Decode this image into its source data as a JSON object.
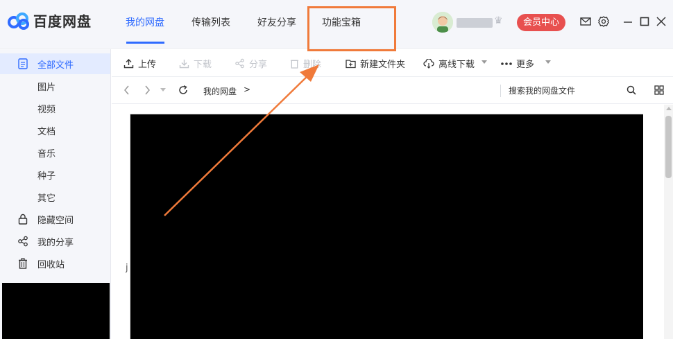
{
  "app": {
    "name": "百度网盘",
    "brand_color": "#2f6bff",
    "accent_color": "#e8504f",
    "highlight_color": "#f07a3a"
  },
  "nav": {
    "tabs": [
      {
        "label": "我的网盘",
        "active": true
      },
      {
        "label": "传输列表",
        "active": false
      },
      {
        "label": "好友分享",
        "active": false
      },
      {
        "label": "功能宝箱",
        "active": false
      }
    ]
  },
  "user": {
    "vip_button": "会员中心",
    "icons": [
      "mail-icon",
      "gear-icon",
      "minimize-icon",
      "maximize-icon",
      "close-icon"
    ]
  },
  "sidebar": {
    "items": [
      {
        "label": "全部文件",
        "icon": "file-icon",
        "active": true
      },
      {
        "label": "图片"
      },
      {
        "label": "视频"
      },
      {
        "label": "文档"
      },
      {
        "label": "音乐"
      },
      {
        "label": "种子"
      },
      {
        "label": "其它"
      },
      {
        "label": "隐藏空间",
        "icon": "lock-icon"
      },
      {
        "label": "我的分享",
        "icon": "share-icon"
      },
      {
        "label": "回收站",
        "icon": "trash-icon"
      }
    ]
  },
  "toolbar": {
    "upload": "上传",
    "download": "下载",
    "share": "分享",
    "delete": "删除",
    "new_folder": "新建文件夹",
    "offline_download": "离线下载",
    "more": "更多"
  },
  "pathbar": {
    "breadcrumb": "我的网盘",
    "separator": ">",
    "search_placeholder": "搜索我的网盘文件"
  },
  "content": {
    "stray_text": "j"
  }
}
